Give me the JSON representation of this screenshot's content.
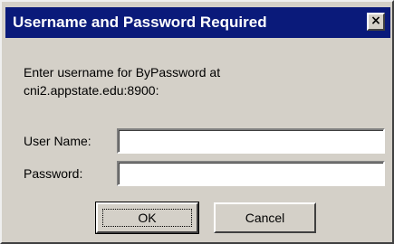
{
  "dialog": {
    "title": "Username and Password Required",
    "close_glyph": "×",
    "close_icon": "close-icon",
    "prompt_line1": "Enter username for ByPassword at",
    "prompt_line2": "cni2.appstate.edu:8900:",
    "username_label": "User Name:",
    "username_value": "",
    "password_label": "Password:",
    "password_value": "",
    "ok_label": "OK",
    "cancel_label": "Cancel"
  },
  "colors": {
    "title_bar": "#0a1a7a",
    "dialog_face": "#d4d0c8",
    "input_background": "#ffffff"
  }
}
